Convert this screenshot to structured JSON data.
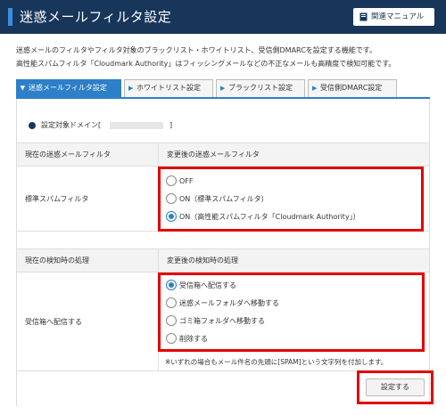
{
  "header": {
    "title": "迷惑メールフィルタ設定",
    "manual_label": "関連マニュアル"
  },
  "intro": {
    "line1": "迷惑メールのフィルタやフィルタ対象のブラックリスト・ホワイトリスト、受信側DMARCを設定する機能です。",
    "line2": "高性能スパムフィルタ「Cloudmark Authority」はフィッシングメールなどの不正なメールも高精度で検知可能です。"
  },
  "tabs": [
    {
      "label": "迷惑メールフィルタ設定",
      "active": true
    },
    {
      "label": "ホワイトリスト設定",
      "active": false
    },
    {
      "label": "ブラックリスト設定",
      "active": false
    },
    {
      "label": "受信側DMARC設定",
      "active": false
    }
  ],
  "domain": {
    "label": "設定対象ドメイン[",
    "close": "]"
  },
  "filter_table": {
    "col_current": "現在の迷惑メールフィルタ",
    "col_new": "変更後の迷惑メールフィルタ",
    "current_value": "標準スパムフィルタ",
    "options": [
      {
        "label": "OFF",
        "selected": false
      },
      {
        "label": "ON（標準スパムフィルタ）",
        "selected": false
      },
      {
        "label": "ON（高性能スパムフィルタ「Cloudmark Authority」）",
        "selected": true
      }
    ]
  },
  "action_table": {
    "col_current": "現在の検知時の処理",
    "col_new": "変更後の検知時の処理",
    "current_value": "受信箱へ配信する",
    "options": [
      {
        "label": "受信箱へ配信する",
        "selected": true
      },
      {
        "label": "迷惑メールフォルダへ移動する",
        "selected": false
      },
      {
        "label": "ゴミ箱フォルダへ移動する",
        "selected": false
      },
      {
        "label": "削除する",
        "selected": false
      }
    ],
    "note": "※いずれの場合もメール件名の先頭に[SPAM]という文字列を付加します。"
  },
  "submit_label": "設定する",
  "colors": {
    "header_bg": "#17365a",
    "accent": "#2d7fc8",
    "highlight": "#e00000"
  }
}
